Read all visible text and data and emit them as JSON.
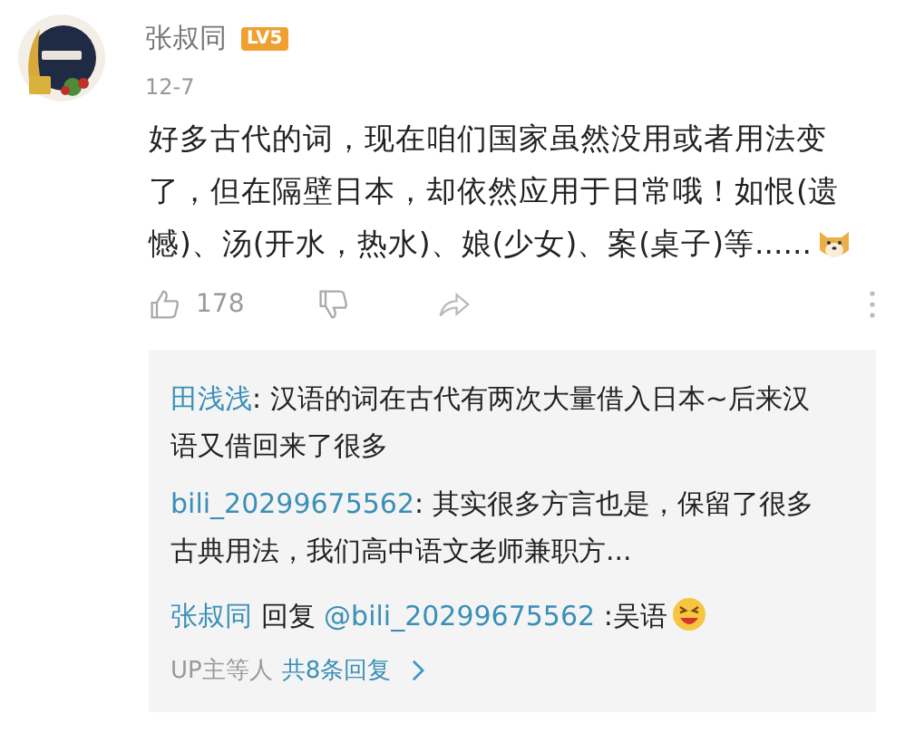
{
  "comment": {
    "author": "张叔同",
    "level_badge": "LV5",
    "date": "12-7",
    "text": "好多古代的词，现在咱们国家虽然没用或者用法变了，但在隔壁日本，却依然应用于日常哦！如恨(遗憾)、汤(开水，热水)、娘(少女)、案(桌子)等......",
    "emoji": true,
    "likes": "178"
  },
  "replies": [
    {
      "kind": "reply",
      "author": "田浅浅",
      "text": ": 汉语的词在古代有两次大量借入日本~后来汉语又借回来了很多",
      "emoji": false
    },
    {
      "kind": "reply",
      "author": "bili_20299675562",
      "text": ": 其实很多方言也是，保留了很多古典用法，我们高中语文老师兼职方...",
      "emoji": false
    },
    {
      "kind": "reply_to",
      "author": "张叔同",
      "reply_word": "回复",
      "mention": "@bili_20299675562",
      "text": " :吴语",
      "emoji": true
    }
  ],
  "footer": {
    "prefix": "UP主等人",
    "link": "共8条回复"
  }
}
